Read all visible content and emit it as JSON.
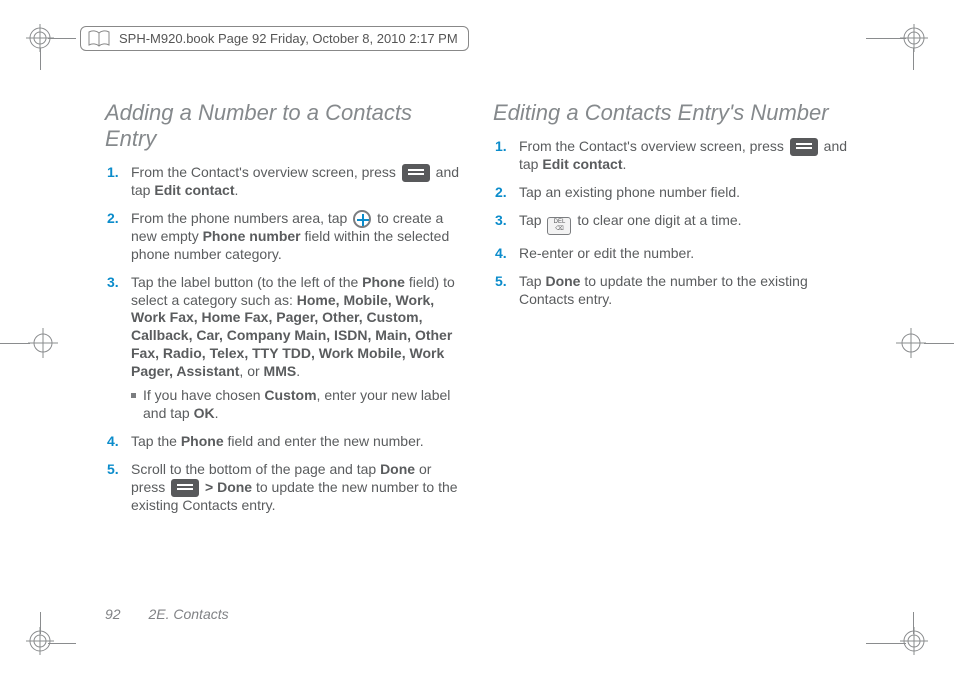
{
  "header": {
    "text": "SPH-M920.book  Page 92  Friday, October 8, 2010  2:17 PM"
  },
  "left": {
    "title": "Adding a Number to a Contacts Entry",
    "steps": {
      "s1a": "From the Contact's overview screen, press ",
      "s1b": " and tap ",
      "s1c": "Edit contact",
      "s1d": ".",
      "s2a": "From the phone numbers area, tap ",
      "s2b": " to create a new empty ",
      "s2c": "Phone number",
      "s2d": " field within the selected phone number category.",
      "s3a": "Tap the label button (to the left of the ",
      "s3b": "Phone",
      "s3c": " field) to select a category such as: ",
      "s3cats": "Home, Mobile, Work, Work Fax, Home Fax, Pager, Other, Custom, Callback, Car, Company Main, ISDN, Main, Other Fax, Radio, Telex, TTY TDD, Work Mobile, Work Pager, Assistant",
      "s3or": ", or ",
      "s3last": "MMS",
      "s3end": ".",
      "s3suba": "If you have chosen ",
      "s3subb": "Custom",
      "s3subc": ", enter your new label and tap ",
      "s3subd": "OK",
      "s3sube": ".",
      "s4a": "Tap the ",
      "s4b": "Phone",
      "s4c": " field and enter the new number.",
      "s5a": "Scroll to the bottom of the page and tap ",
      "s5b": "Done",
      "s5c": " or press ",
      "s5d": " > ",
      "s5e": "Done",
      "s5f": " to update the new number to the existing Contacts entry."
    }
  },
  "right": {
    "title": "Editing a Contacts Entry's Number",
    "steps": {
      "s1a": "From the Contact's overview screen, press ",
      "s1b": " and tap ",
      "s1c": "Edit contact",
      "s1d": ".",
      "s2": "Tap an existing phone number field.",
      "s3a": "Tap ",
      "s3b": " to clear one digit at a time.",
      "s4": "Re-enter or edit the number.",
      "s5a": "Tap ",
      "s5b": "Done",
      "s5c": " to update the number to the existing Contacts entry."
    }
  },
  "footer": {
    "page": "92",
    "section": "2E. Contacts"
  },
  "del_label": "DEL"
}
